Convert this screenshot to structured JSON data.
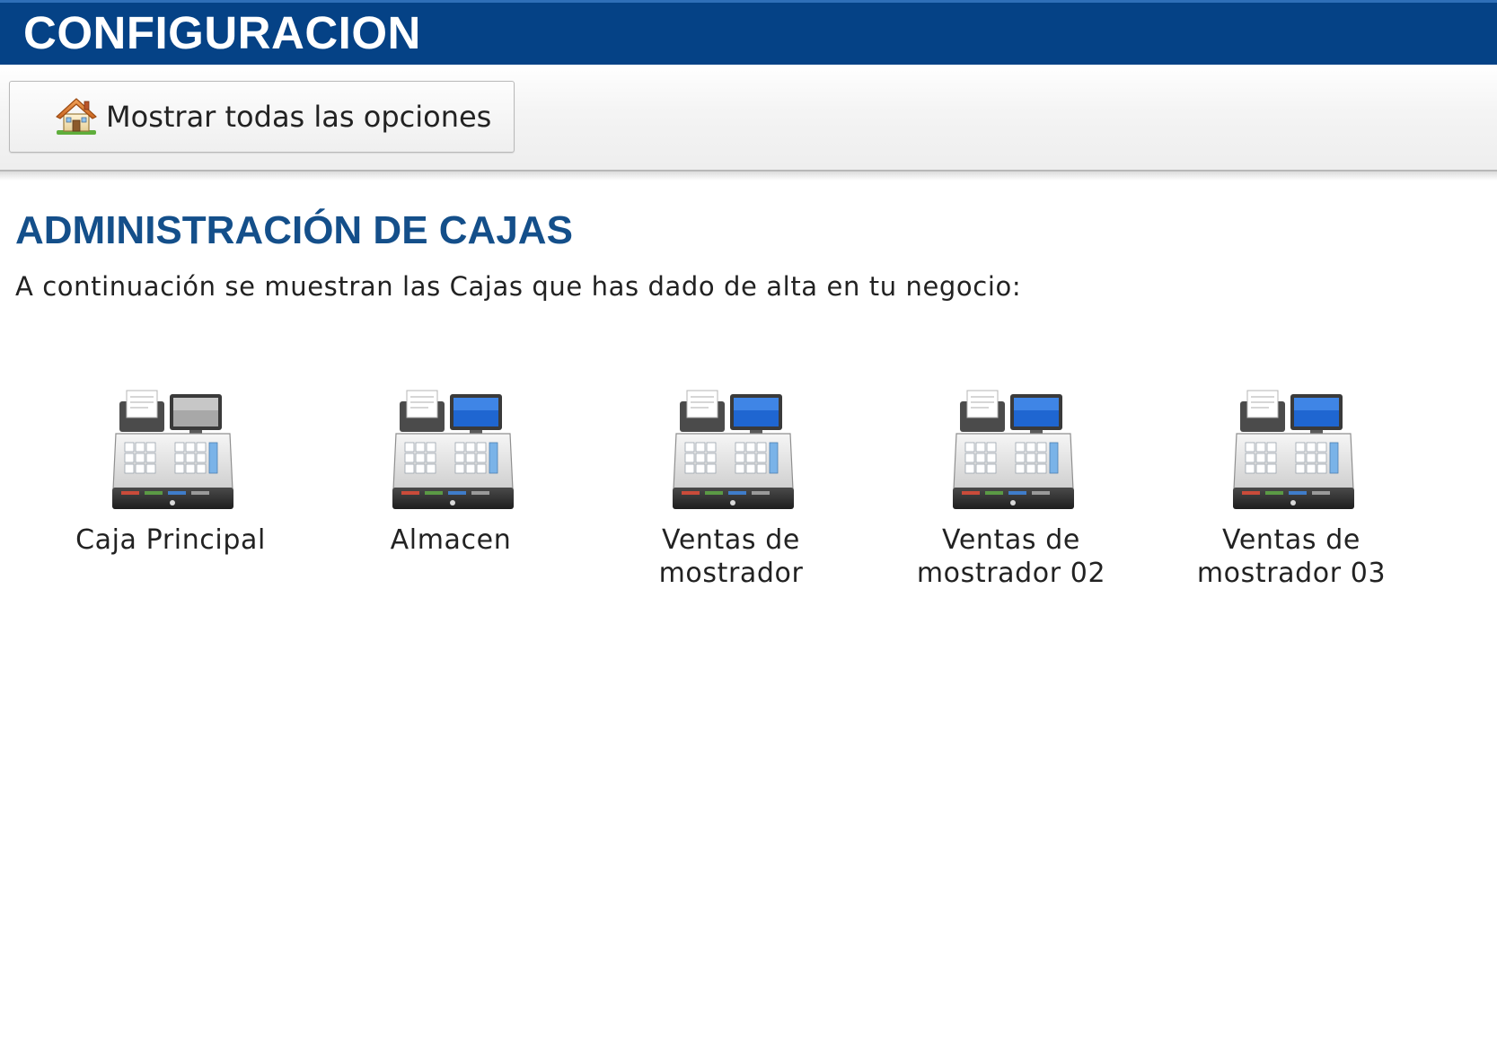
{
  "header": {
    "title": "CONFIGURACION",
    "bar_color": "#054286"
  },
  "toolbar": {
    "show_all_label": "Mostrar todas las opciones",
    "show_all_icon": "home-icon"
  },
  "section": {
    "title": "ADMINISTRACIÓN DE CAJAS",
    "description": "A continuación se muestran las Cajas que has dado de alta en tu negocio:",
    "title_color": "#144f8a"
  },
  "cajas": [
    {
      "label_line1": "Caja Principal",
      "label_line2": "",
      "icon": "cash-register-icon",
      "screen": "gray"
    },
    {
      "label_line1": "Almacen",
      "label_line2": "",
      "icon": "cash-register-icon",
      "screen": "blue"
    },
    {
      "label_line1": "Ventas de",
      "label_line2": "mostrador",
      "icon": "cash-register-icon",
      "screen": "blue"
    },
    {
      "label_line1": "Ventas de",
      "label_line2": "mostrador 02",
      "icon": "cash-register-icon",
      "screen": "blue"
    },
    {
      "label_line1": "Ventas de",
      "label_line2": "mostrador 03",
      "icon": "cash-register-icon",
      "screen": "blue"
    }
  ]
}
